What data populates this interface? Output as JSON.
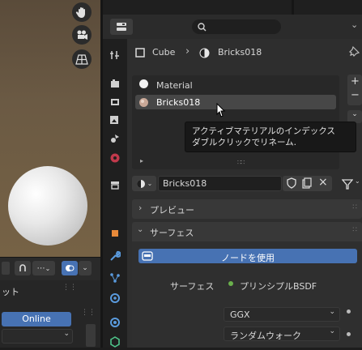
{
  "breadcrumb": {
    "object": "Cube",
    "material": "Bricks018"
  },
  "material_slots": [
    {
      "label": "Material"
    },
    {
      "label": "Bricks018"
    }
  ],
  "tooltip": {
    "line1": "アクティブマテリアルのインデックス",
    "line2": "ダブルクリックでリネーム."
  },
  "material_name": "Bricks018",
  "panels": {
    "preview": "プレビュー",
    "surface": "サーフェス"
  },
  "use_nodes_label": "ノードを使用",
  "surface_label": "サーフェス",
  "surface_shader": "プリンシプルBSDF",
  "distribution": "GGX",
  "subsurface_method": "ランダムウォーク",
  "left_panel": {
    "label": "ット",
    "online_button": "Online"
  },
  "colors": {
    "accent_blue": "#4772b3",
    "shader_dot": "#6ab04c"
  }
}
